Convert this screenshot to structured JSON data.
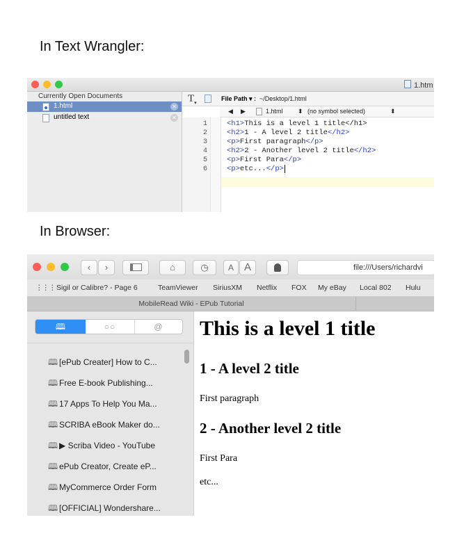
{
  "captions": {
    "textwrangler": "In Text Wrangler:",
    "browser": "In Browser:"
  },
  "textwrangler": {
    "window_title": "1.htm",
    "traffic_colors": [
      "#fc5f57",
      "#fdbc2e",
      "#34c84a"
    ],
    "sidebar_header": "Currently Open Documents",
    "documents": [
      {
        "label": "1.html",
        "selected": true,
        "icon": "html-file-icon"
      },
      {
        "label": "untitled text",
        "selected": false,
        "icon": "text-file-icon"
      }
    ],
    "toolbar": {
      "text_tool": "T",
      "file_path_label": "File Path ▾ :",
      "file_path_value": "~/Desktop/1.html"
    },
    "navbar": {
      "back": "◀",
      "forward": "▶",
      "file": "1.html",
      "file_arrows": "⬍",
      "symbol": "(no symbol selected)",
      "symbol_arrows": "⬍"
    },
    "line_numbers": [
      "1",
      "2",
      "3",
      "4",
      "5",
      "6"
    ],
    "code_lines": [
      {
        "open": "<h1>",
        "text": "This is a level 1 title",
        "close": "</h1>"
      },
      {
        "open": "<h2>",
        "text": "1 - A level 2 title",
        "close": "</h2>"
      },
      {
        "open": "<p>",
        "text": "First paragraph",
        "close": "</p>"
      },
      {
        "open": "<h2>",
        "text": "2 - Another level 2 title",
        "close": "</h2>"
      },
      {
        "open": "<p>",
        "text": "First Para",
        "close": "</p>"
      },
      {
        "open": "<p>",
        "text": "etc...",
        "close": "</p>"
      }
    ],
    "tag_color": "#2c40c9"
  },
  "safari": {
    "traffic_colors": [
      "#fc5f57",
      "#fdbc2e",
      "#34c84a"
    ],
    "url": "file:///Users/richardvi",
    "buttons": {
      "back": "‹",
      "forward": "›",
      "home": "⌂",
      "history": "◷",
      "font_small": "A",
      "font_large": "A"
    },
    "favorites": [
      "Sigil or Calibre? - Page 6",
      "TeamViewer",
      "SiriusXM",
      "Netflix",
      "FOX",
      "My eBay",
      "Local 802",
      "Hulu"
    ],
    "tab_title": "MobileRead Wiki - EPub Tutorial",
    "segments": [
      "bookmarks-icon",
      "reading-list-icon",
      "shared-links-icon"
    ],
    "reading_list": [
      "[ePub Creater] How to C...",
      "Free E-book Publishing...",
      "17 Apps To Help You Ma...",
      "SCRIBA eBook Maker do...",
      "▶ Scriba Video - YouTube",
      "ePub Creator, Create eP...",
      "MyCommerce Order Form",
      "[OFFICIAL] Wondershare..."
    ],
    "page": {
      "h1": "This is a level 1 title",
      "h2_first": "1 - A level 2 title",
      "p_first": "First paragraph",
      "h2_second": "2 - Another level 2 title",
      "p_second": "First Para",
      "p_third": "etc..."
    }
  }
}
